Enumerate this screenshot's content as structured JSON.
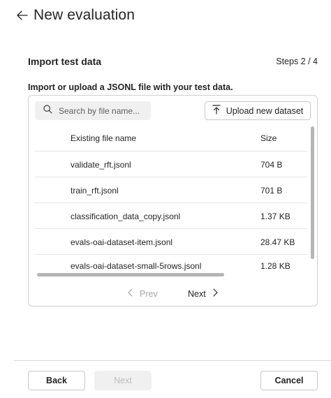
{
  "header": {
    "title": "New evaluation",
    "back_icon": "arrow-left-icon"
  },
  "step": {
    "title": "Import test data",
    "counter": "Steps 2 / 4"
  },
  "instruction": "Import or upload a JSONL file with your test data.",
  "search": {
    "placeholder": "Search by file name...",
    "value": "",
    "icon": "search-icon"
  },
  "upload": {
    "label": "Upload new dataset",
    "icon": "upload-icon"
  },
  "table": {
    "columns": [
      "Existing file name",
      "Size"
    ],
    "rows": [
      {
        "name": "validate_rft.jsonl",
        "size": "704 B"
      },
      {
        "name": "train_rft.jsonl",
        "size": "701 B"
      },
      {
        "name": "classification_data_copy.jsonl",
        "size": "1.37 KB"
      },
      {
        "name": "evals-oai-dataset-item.jsonl",
        "size": "28.47 KB"
      },
      {
        "name": "evals-oai-dataset-small-5rows.jsonl",
        "size": "1.28 KB"
      }
    ]
  },
  "pager": {
    "prev_label": "Prev",
    "next_label": "Next",
    "prev_enabled": false,
    "next_enabled": true
  },
  "footer": {
    "back_label": "Back",
    "next_label": "Next",
    "cancel_label": "Cancel",
    "next_enabled": false
  },
  "colors": {
    "text": "#242424",
    "disabled": "#a6a6a6",
    "border": "#d1d1d1",
    "search_bg": "#f0f0f0"
  }
}
